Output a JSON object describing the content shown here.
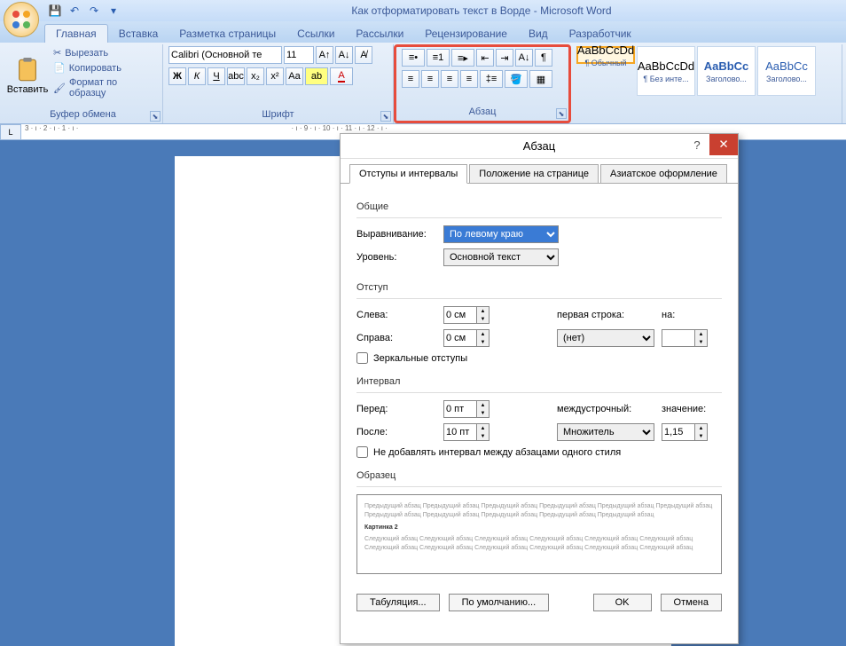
{
  "app": {
    "title": "Как отформатировать текст в Ворде - Microsoft Word"
  },
  "tabs": {
    "home": "Главная",
    "insert": "Вставка",
    "layout": "Разметка страницы",
    "refs": "Ссылки",
    "mail": "Рассылки",
    "review": "Рецензирование",
    "view": "Вид",
    "dev": "Разработчик"
  },
  "clipboard": {
    "paste": "Вставить",
    "cut": "Вырезать",
    "copy": "Копировать",
    "format_painter": "Формат по образцу",
    "label": "Буфер обмена"
  },
  "font": {
    "name": "Calibri (Основной те",
    "size": "11",
    "label": "Шрифт",
    "bold": "Ж",
    "italic": "К",
    "underline": "Ч"
  },
  "paragraph": {
    "label": "Абзац"
  },
  "styles": {
    "items": [
      {
        "preview": "AaBbCcDd",
        "name": "¶ Обычный"
      },
      {
        "preview": "AaBbCcDd",
        "name": "¶ Без инте..."
      },
      {
        "preview": "AaBbCc",
        "name": "Заголово..."
      },
      {
        "preview": "AaBbCc",
        "name": "Заголово..."
      }
    ]
  },
  "ruler": "3 · ı · 2 · ı · 1 · ı ·                                                                                                            · ı · 9 · ı · 10 · ı · 11 · ı · 12 · ı ·",
  "dialog": {
    "title": "Абзац",
    "tabs": {
      "t1": "Отступы и интервалы",
      "t2": "Положение на странице",
      "t3": "Азиатское оформление"
    },
    "general": {
      "label": "Общие",
      "align_lbl": "Выравнивание:",
      "align_val": "По левому краю",
      "level_lbl": "Уровень:",
      "level_val": "Основной текст"
    },
    "indent": {
      "label": "Отступ",
      "left_lbl": "Слева:",
      "left_val": "0 см",
      "right_lbl": "Справа:",
      "right_val": "0 см",
      "first_lbl": "первая строка:",
      "first_val": "(нет)",
      "by_lbl": "на:",
      "mirror": "Зеркальные отступы"
    },
    "spacing": {
      "label": "Интервал",
      "before_lbl": "Перед:",
      "before_val": "0 пт",
      "after_lbl": "После:",
      "after_val": "10 пт",
      "line_lbl": "междустрочный:",
      "line_val": "Множитель",
      "at_lbl": "значение:",
      "at_val": "1,15",
      "no_add": "Не добавлять интервал между абзацами одного стиля"
    },
    "preview": {
      "label": "Образец",
      "prev_text": "Предыдущий абзац Предыдущий абзац Предыдущий абзац Предыдущий абзац Предыдущий абзац Предыдущий абзац Предыдущий абзац Предыдущий абзац Предыдущий абзац Предыдущий абзац Предыдущий абзац",
      "sample": "Картинка 2",
      "next_text": "Следующий абзац Следующий абзац Следующий абзац Следующий абзац Следующий абзац Следующий абзац Следующий абзац Следующий абзац Следующий абзац Следующий абзац Следующий абзац Следующий абзац"
    },
    "buttons": {
      "tabs": "Табуляция...",
      "default": "По умолчанию...",
      "ok": "OK",
      "cancel": "Отмена"
    }
  }
}
